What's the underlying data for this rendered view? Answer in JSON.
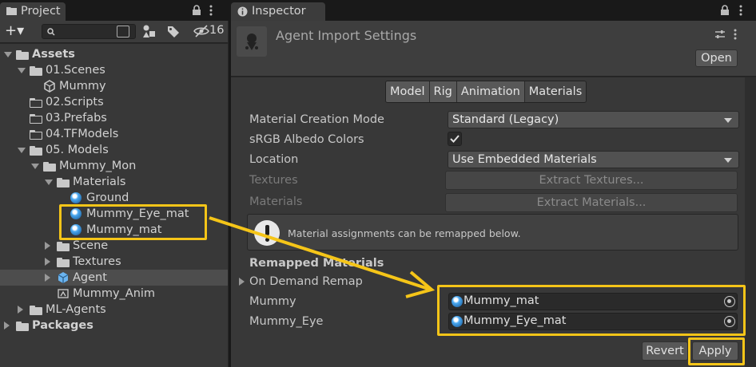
{
  "project": {
    "tab_label": "Project",
    "add_label": "+▾",
    "hidden_count": "16",
    "tree": [
      {
        "label": "Assets",
        "depth": 0,
        "arrow": "down",
        "icon": "folder",
        "bold": true
      },
      {
        "label": "01.Scenes",
        "depth": 1,
        "arrow": "down",
        "icon": "folder"
      },
      {
        "label": "Mummy",
        "depth": 2,
        "arrow": "none",
        "icon": "unity-scene"
      },
      {
        "label": "02.Scripts",
        "depth": 1,
        "arrow": "none",
        "icon": "folder-outline"
      },
      {
        "label": "03.Prefabs",
        "depth": 1,
        "arrow": "none",
        "icon": "folder-outline"
      },
      {
        "label": "04.TFModels",
        "depth": 1,
        "arrow": "none",
        "icon": "folder-outline"
      },
      {
        "label": "05. Models",
        "depth": 1,
        "arrow": "down",
        "icon": "folder"
      },
      {
        "label": "Mummy_Mon",
        "depth": 2,
        "arrow": "down",
        "icon": "folder"
      },
      {
        "label": "Materials",
        "depth": 3,
        "arrow": "down",
        "icon": "folder"
      },
      {
        "label": "Ground",
        "depth": 4,
        "arrow": "none",
        "icon": "material"
      },
      {
        "label": "Mummy_Eye_mat",
        "depth": 4,
        "arrow": "none",
        "icon": "material"
      },
      {
        "label": "Mummy_mat",
        "depth": 4,
        "arrow": "none",
        "icon": "material"
      },
      {
        "label": "Scene",
        "depth": 3,
        "arrow": "right",
        "icon": "folder-filled"
      },
      {
        "label": "Textures",
        "depth": 3,
        "arrow": "right",
        "icon": "folder-filled"
      },
      {
        "label": "Agent",
        "depth": 3,
        "arrow": "right",
        "icon": "model",
        "selected": true
      },
      {
        "label": "Mummy_Anim",
        "depth": 3,
        "arrow": "none",
        "icon": "animation"
      },
      {
        "label": "ML-Agents",
        "depth": 1,
        "arrow": "right",
        "icon": "folder-filled"
      },
      {
        "label": "Packages",
        "depth": 0,
        "arrow": "right",
        "icon": "folder-filled",
        "bold": true
      }
    ]
  },
  "inspector": {
    "tab_label": "Inspector",
    "title": "Agent Import Settings",
    "open_label": "Open",
    "tabs": [
      "Model",
      "Rig",
      "Animation",
      "Materials"
    ],
    "active_tab": "Materials",
    "material_creation_mode": {
      "label": "Material Creation Mode",
      "value": "Standard (Legacy)"
    },
    "srgb": {
      "label": "sRGB Albedo Colors",
      "checked": true
    },
    "location": {
      "label": "Location",
      "value": "Use Embedded Materials"
    },
    "textures": {
      "label": "Textures",
      "button": "Extract Textures..."
    },
    "materials": {
      "label": "Materials",
      "button": "Extract Materials..."
    },
    "info_message": "Material assignments can be remapped below.",
    "remapped_header": "Remapped Materials",
    "on_demand": "On Demand Remap",
    "remaps": [
      {
        "label": "Mummy",
        "value": "Mummy_mat"
      },
      {
        "label": "Mummy_Eye",
        "value": "Mummy_Eye_mat"
      }
    ],
    "revert_label": "Revert",
    "apply_label": "Apply"
  },
  "colors": {
    "highlight": "#f5c518",
    "selection": "#4d4d4d",
    "material_blue": "#4aa8f0"
  }
}
